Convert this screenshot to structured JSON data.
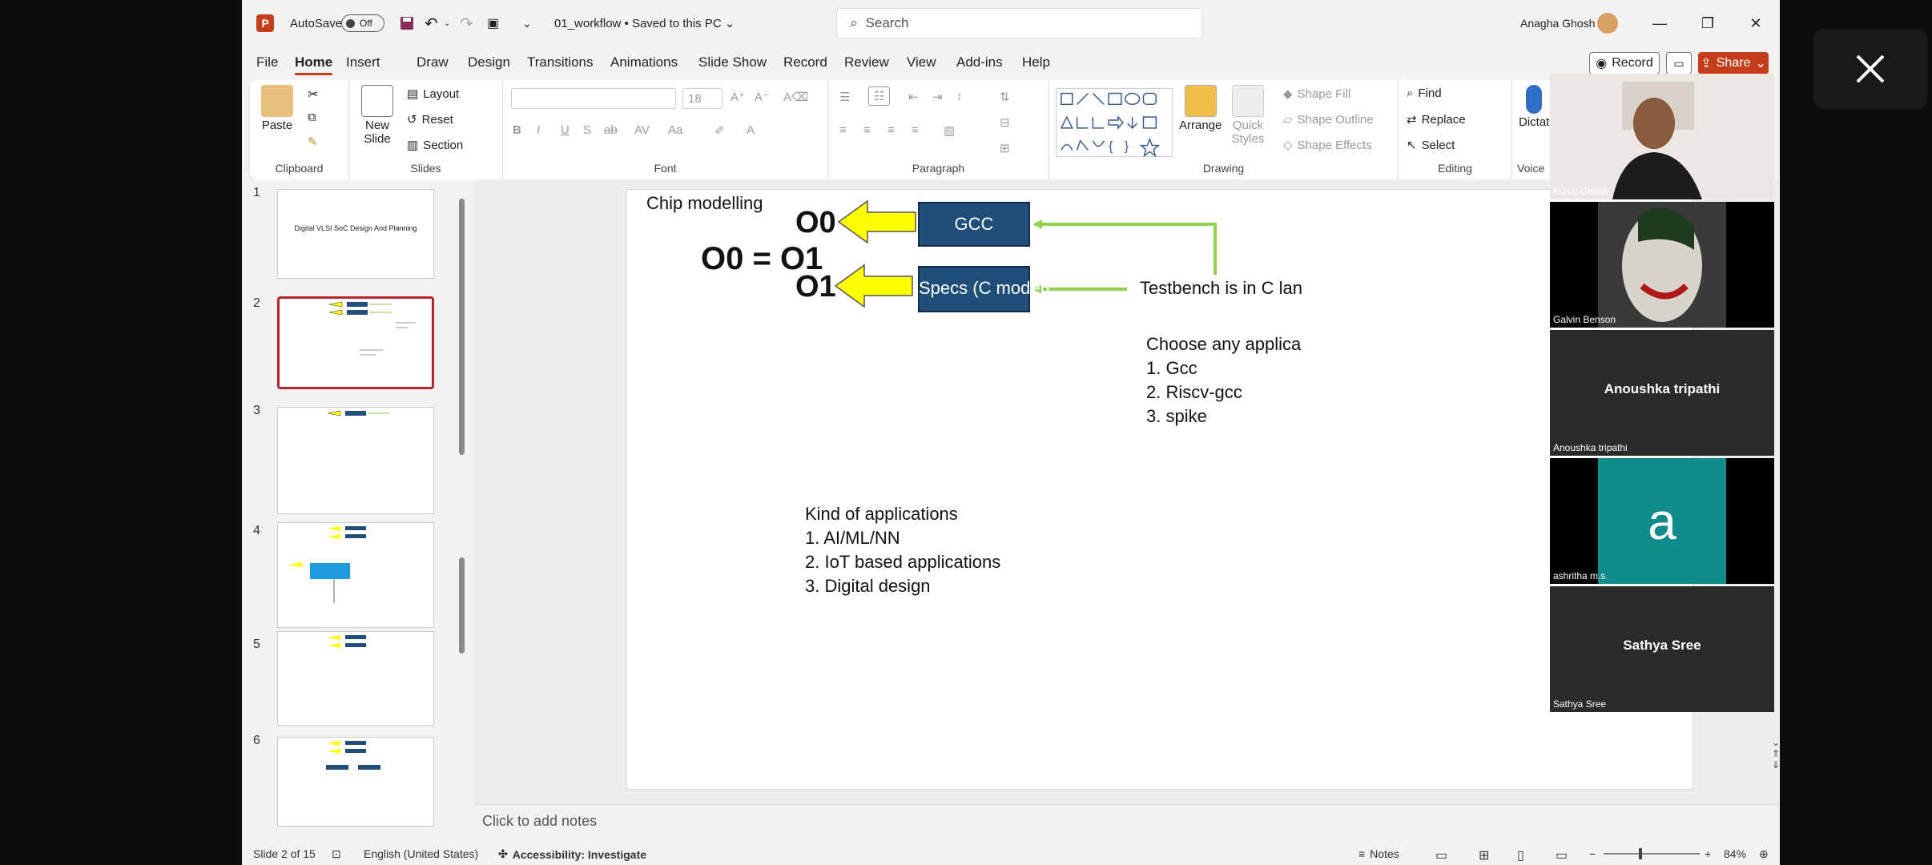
{
  "titlebar": {
    "app_logo": "P",
    "autosave_label": "AutoSave",
    "autosave_state": "Off",
    "file_title": "01_workflow • Saved to this PC",
    "search_placeholder": "Search",
    "user_name": "Anagha Ghosh",
    "minimize": "—",
    "restore": "❐",
    "close": "✕"
  },
  "menu": {
    "tabs": [
      "File",
      "Home",
      "Insert",
      "Draw",
      "Design",
      "Transitions",
      "Animations",
      "Slide Show",
      "Record",
      "Review",
      "View",
      "Add-ins",
      "Help"
    ],
    "active": "Home",
    "record_label": "Record",
    "share_label": "Share"
  },
  "ribbon": {
    "clipboard": {
      "label": "Clipboard",
      "paste": "Paste"
    },
    "slides": {
      "label": "Slides",
      "new_slide": "New Slide",
      "layout": "Layout",
      "reset": "Reset",
      "section": "Section"
    },
    "font": {
      "label": "Font",
      "size": "18"
    },
    "paragraph": {
      "label": "Paragraph"
    },
    "drawing": {
      "label": "Drawing",
      "arrange": "Arrange",
      "quick_styles": "Quick Styles",
      "shape_fill": "Shape Fill",
      "shape_outline": "Shape Outline",
      "shape_effects": "Shape Effects"
    },
    "editing": {
      "label": "Editing",
      "find": "Find",
      "replace": "Replace",
      "select": "Select"
    },
    "voice": {
      "label": "Voice",
      "dictate": "Dictat"
    }
  },
  "thumbnails": [
    {
      "num": "1",
      "title": "Digital VLSI SoC Design And Planning"
    },
    {
      "num": "2",
      "title": ""
    },
    {
      "num": "3",
      "title": ""
    },
    {
      "num": "4",
      "title": ""
    },
    {
      "num": "5",
      "title": ""
    },
    {
      "num": "6",
      "title": ""
    }
  ],
  "slide": {
    "title": "Chip modelling",
    "equation": "O0 = O1",
    "o0": "O0",
    "o1": "O1",
    "gcc_box": "GCC",
    "specs_box": "Specs (C model)",
    "testbench": "Testbench is in C lan",
    "choose_title": "Choose any applica",
    "choose_items": [
      "1.   Gcc",
      "2.   Riscv-gcc",
      "3.   spike"
    ],
    "kind_title": "Kind of applications",
    "kind_items": [
      "1.   AI/ML/NN",
      "2.   IoT based applications",
      "3.   Digital design"
    ],
    "colors": {
      "box": "#1f4e79",
      "arrow": "#ffff00",
      "line": "#92d050"
    }
  },
  "notes_placeholder": "Click to add notes",
  "status": {
    "slide_info": "Slide 2 of 15",
    "language": "English (United States)",
    "accessibility": "Accessibility: Investigate",
    "notes": "Notes",
    "zoom": "84%"
  },
  "call": {
    "participants": [
      {
        "name": "Kunal Ghosh",
        "type": "video"
      },
      {
        "name": "Galvin Benson",
        "type": "video"
      },
      {
        "name": "Anoushka tripathi",
        "type": "name"
      },
      {
        "name": "ashritha m.s",
        "type": "avatar",
        "letter": "a"
      },
      {
        "name": "Sathya Sree",
        "type": "name"
      }
    ]
  }
}
